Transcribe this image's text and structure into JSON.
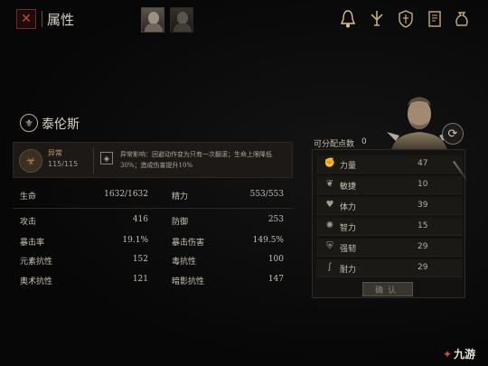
{
  "header": {
    "title": "属性",
    "close_icon": "close-x-icon",
    "portraits": [
      "hero-portrait-1",
      "hero-portrait-2"
    ],
    "top_icons": [
      "hand-bell-icon",
      "sword-emblem-icon",
      "shield-crest-icon",
      "book-icon",
      "pouch-icon"
    ]
  },
  "character": {
    "name": "泰伦斯",
    "emblem_icon": "dragon-emblem-icon"
  },
  "status": {
    "name": "异常",
    "value": "115/115",
    "effect_text": "异常影响：回避动作变为只有一次翻滚；生命上限降低30%；造成伤害提升10%"
  },
  "stats": [
    {
      "label": "生命",
      "value": "1632/1632"
    },
    {
      "label": "精力",
      "value": "553/553"
    },
    {
      "label": "攻击",
      "value": "416"
    },
    {
      "label": "防御",
      "value": "253"
    },
    {
      "label": "暴击率",
      "value": "19.1%"
    },
    {
      "label": "暴击伤害",
      "value": "149.5%"
    },
    {
      "label": "元素抗性",
      "value": "152"
    },
    {
      "label": "毒抗性",
      "value": "100"
    },
    {
      "label": "奥术抗性",
      "value": "121"
    },
    {
      "label": "暗影抗性",
      "value": "147"
    }
  ],
  "attributes": {
    "points_label": "可分配点数",
    "points_value": "0",
    "items": [
      {
        "label": "力量",
        "value": "47",
        "icon": "fist-icon"
      },
      {
        "label": "敏捷",
        "value": "10",
        "icon": "feather-icon"
      },
      {
        "label": "体力",
        "value": "39",
        "icon": "heart-body-icon"
      },
      {
        "label": "智力",
        "value": "15",
        "icon": "brain-icon"
      },
      {
        "label": "强韧",
        "value": "29",
        "icon": "armor-icon"
      },
      {
        "label": "耐力",
        "value": "29",
        "icon": "leg-icon"
      }
    ],
    "confirm_label": "确认",
    "reset_icon": "reset-cycle-icon"
  },
  "watermark": {
    "text": "九游"
  },
  "colors": {
    "accent_gold": "#c8ad7d",
    "close_red": "#d2452f",
    "background": "#070707"
  }
}
